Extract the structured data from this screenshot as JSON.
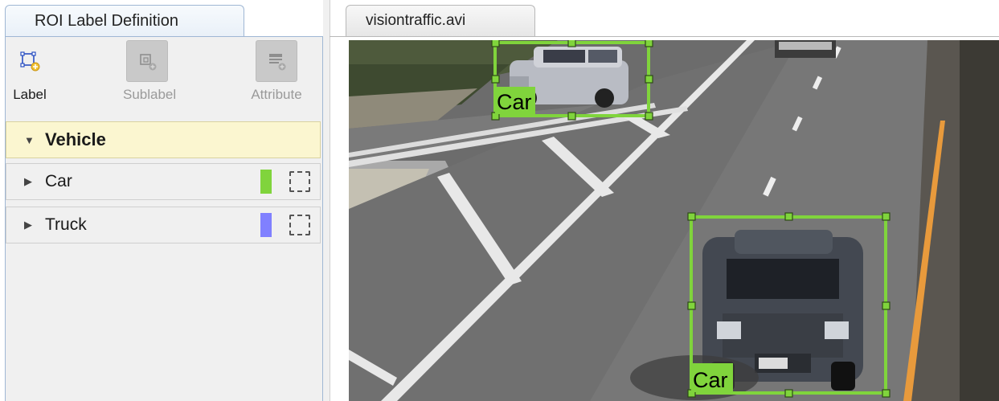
{
  "left_panel": {
    "tab_title": "ROI Label Definition",
    "toolbar": {
      "label_button": "Label",
      "sublabel_button": "Sublabel",
      "attribute_button": "Attribute"
    },
    "labels": [
      {
        "name": "Vehicle",
        "expanded": true,
        "color": ""
      },
      {
        "name": "Car",
        "expanded": false,
        "color": "#80d43c"
      },
      {
        "name": "Truck",
        "expanded": false,
        "color": "#8080ff"
      }
    ]
  },
  "video": {
    "tab_title": "visiontraffic.avi",
    "annotations": [
      {
        "label": "Car",
        "color": "#80d43c"
      },
      {
        "label": "Car",
        "color": "#80d43c"
      }
    ]
  },
  "colors": {
    "accent_blue": "#9fb7d4",
    "label_green": "#80d43c",
    "label_purple": "#8080ff",
    "vehicle_highlight": "#fbf6d0"
  }
}
